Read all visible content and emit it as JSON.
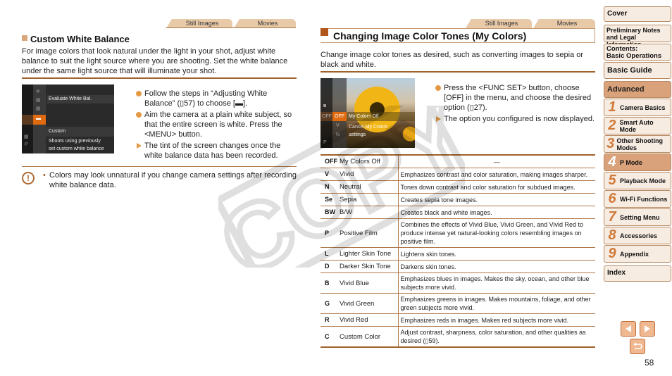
{
  "left": {
    "tabs": [
      "Still Images",
      "Movies"
    ],
    "title": "Custom White Balance",
    "intro": "For image colors that look natural under the light in your shot, adjust white balance to suit the light source where you are shooting. Set the white balance under the same light source that will illuminate your shot.",
    "screen": {
      "menu_label": "Evaluate White Bal.",
      "option_name": "Custom",
      "option_desc_1": "Shoots using previously",
      "option_desc_2": "set custom white balance"
    },
    "steps": [
      {
        "type": "bullet",
        "text": "Follow the steps in “Adjusting White Balance” (▯57) to choose [▬]."
      },
      {
        "type": "bullet",
        "text": "Aim the camera at a plain white subject, so that the entire screen is white. Press the <MENU> button."
      },
      {
        "type": "result",
        "text": "The tint of the screen changes once the white balance data has been recorded."
      }
    ],
    "caution": "Colors may look unnatural if you change camera settings after recording white balance data."
  },
  "right": {
    "tabs": [
      "Still Images",
      "Movies"
    ],
    "title": "Changing Image Color Tones (My Colors)",
    "intro": "Change image color tones as desired, such as converting images to sepia or black and white.",
    "screen": {
      "option_name": "My Colors Off",
      "option_desc_1": "Cancel My Colors",
      "option_desc_2": "settings"
    },
    "steps": [
      {
        "type": "bullet",
        "text": "Press the <FUNC SET> button, choose [OFF] in the menu, and choose the desired option (▯27)."
      },
      {
        "type": "result",
        "text": "The option you configured is now displayed."
      }
    ],
    "table": [
      {
        "icon": "OFF",
        "name": "My Colors Off",
        "desc": "—"
      },
      {
        "icon": "V",
        "name": "Vivid",
        "desc": "Emphasizes contrast and color saturation, making images sharper."
      },
      {
        "icon": "N",
        "name": "Neutral",
        "desc": "Tones down contrast and color saturation for subdued images."
      },
      {
        "icon": "Se",
        "name": "Sepia",
        "desc": "Creates sepia tone images."
      },
      {
        "icon": "BW",
        "name": "B/W",
        "desc": "Creates black and white images."
      },
      {
        "icon": "P",
        "name": "Positive Film",
        "desc": "Combines the effects of Vivid Blue, Vivid Green, and Vivid Red to produce intense yet natural-looking colors resembling images on positive film."
      },
      {
        "icon": "L",
        "name": "Lighter Skin Tone",
        "desc": "Lightens skin tones."
      },
      {
        "icon": "D",
        "name": "Darker Skin Tone",
        "desc": "Darkens skin tones."
      },
      {
        "icon": "B",
        "name": "Vivid Blue",
        "desc": "Emphasizes blues in images. Makes the sky, ocean, and other blue subjects more vivid."
      },
      {
        "icon": "G",
        "name": "Vivid Green",
        "desc": "Emphasizes greens in images. Makes mountains, foliage, and other green subjects more vivid."
      },
      {
        "icon": "R",
        "name": "Vivid Red",
        "desc": "Emphasizes reds in images. Makes red subjects more vivid."
      },
      {
        "icon": "C",
        "name": "Custom Color",
        "desc": "Adjust contrast, sharpness, color saturation, and other qualities as desired (▯59)."
      }
    ]
  },
  "sidebar": {
    "cover": "Cover",
    "prelim": "Preliminary Notes and Legal Information",
    "contents_1": "Contents:",
    "contents_2": "Basic Operations",
    "basic": "Basic Guide",
    "advanced": "Advanced Guide",
    "chapters": [
      {
        "num": "1",
        "label": "Camera Basics"
      },
      {
        "num": "2",
        "label": "Smart Auto Mode"
      },
      {
        "num": "3",
        "label": "Other Shooting Modes"
      },
      {
        "num": "4",
        "label": "P Mode",
        "active": true
      },
      {
        "num": "5",
        "label": "Playback Mode"
      },
      {
        "num": "6",
        "label": "Wi-Fi Functions"
      },
      {
        "num": "7",
        "label": "Setting Menu"
      },
      {
        "num": "8",
        "label": "Accessories"
      },
      {
        "num": "9",
        "label": "Appendix"
      }
    ],
    "index": "Index"
  },
  "page_number": "58",
  "watermark": "COPY",
  "colors": {
    "accent": "#a0622d",
    "tab": "#e8c9a8",
    "bullet": "#e49a44",
    "active_nav": "#d9a27a"
  }
}
